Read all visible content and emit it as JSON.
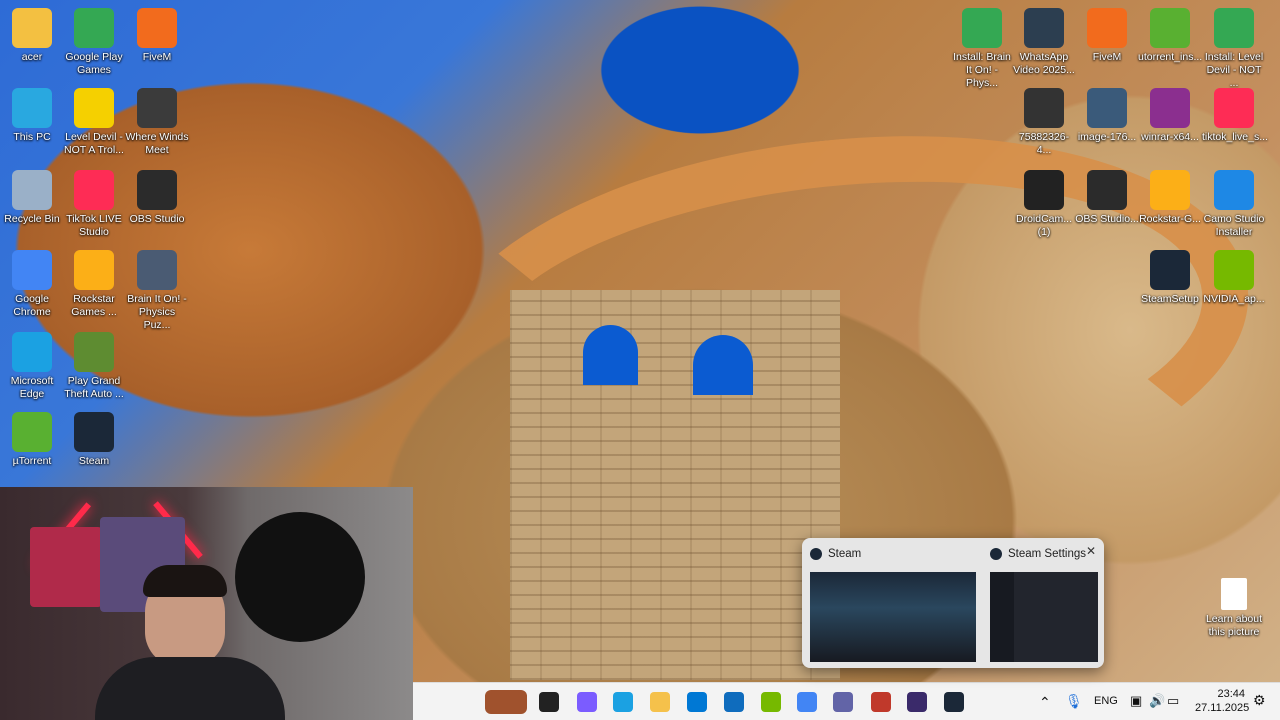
{
  "desktop_left": [
    {
      "label": "acer",
      "icon": "folder-icon",
      "color": "#f3c041"
    },
    {
      "label": "Google Play Games",
      "icon": "google-play-games-icon",
      "color": "#34a853"
    },
    {
      "label": "FiveM",
      "icon": "fivem-icon",
      "color": "#f26b1d"
    },
    {
      "label": "This PC",
      "icon": "monitor-icon",
      "color": "#29a8e0"
    },
    {
      "label": "Level Devil - NOT A Trol...",
      "icon": "level-devil-icon",
      "color": "#f5d000"
    },
    {
      "label": "Where Winds Meet",
      "icon": "where-winds-meet-icon",
      "color": "#3b3b3b"
    },
    {
      "label": "Recycle Bin",
      "icon": "recycle-bin-icon",
      "color": "#9ab0c8"
    },
    {
      "label": "TikTok LIVE Studio",
      "icon": "tiktok-icon",
      "color": "#fe2c55"
    },
    {
      "label": "OBS Studio",
      "icon": "obs-icon",
      "color": "#2b2b2b"
    },
    {
      "label": "Google Chrome",
      "icon": "chrome-icon",
      "color": "#4285f4"
    },
    {
      "label": "Rockstar Games ...",
      "icon": "rockstar-icon",
      "color": "#fcaf17"
    },
    {
      "label": "Brain It On! - Physics Puz...",
      "icon": "brain-it-on-icon",
      "color": "#4a5b73"
    },
    {
      "label": "Microsoft Edge",
      "icon": "edge-icon",
      "color": "#1ba1e2"
    },
    {
      "label": "Play Grand Theft Auto ...",
      "icon": "gta-icon",
      "color": "#5e8c31"
    },
    {
      "label": "µTorrent",
      "icon": "utorrent-icon",
      "color": "#59b031"
    },
    {
      "label": "Steam",
      "icon": "steam-icon",
      "color": "#1b2838"
    }
  ],
  "desktop_right": [
    {
      "label": "Install: Brain It On! - Phys...",
      "icon": "google-play-games-icon",
      "color": "#34a853"
    },
    {
      "label": "WhatsApp Video 2025...",
      "icon": "video-file-icon",
      "color": "#2c3e50"
    },
    {
      "label": "FiveM",
      "icon": "fivem-icon",
      "color": "#f26b1d"
    },
    {
      "label": "utorrent_ins...",
      "icon": "utorrent-icon",
      "color": "#59b031"
    },
    {
      "label": "Install: Level Devil - NOT ...",
      "icon": "google-play-games-icon",
      "color": "#34a853"
    },
    {
      "label": "75882326-4...",
      "icon": "image-file-icon",
      "color": "#333"
    },
    {
      "label": "image-176...",
      "icon": "image-file-icon",
      "color": "#3a5a7a"
    },
    {
      "label": "winrar-x64...",
      "icon": "winrar-icon",
      "color": "#8b2f8f"
    },
    {
      "label": "tiktok_live_s...",
      "icon": "tiktok-icon",
      "color": "#fe2c55"
    },
    {
      "label": "DroidCam... (1)",
      "icon": "droidcam-icon",
      "color": "#222"
    },
    {
      "label": "OBS Studio...",
      "icon": "obs-icon",
      "color": "#2b2b2b"
    },
    {
      "label": "Rockstar-G...",
      "icon": "rockstar-icon",
      "color": "#fcaf17"
    },
    {
      "label": "Camo Studio Installer",
      "icon": "camo-installer-icon",
      "color": "#1e88e5"
    },
    {
      "label": "SteamSetup",
      "icon": "steam-icon",
      "color": "#1b2838"
    },
    {
      "label": "NVIDIA_ap...",
      "icon": "nvidia-icon",
      "color": "#76b900"
    }
  ],
  "learn": {
    "label": "Learn about this picture",
    "icon": "document-icon"
  },
  "preview": {
    "items": [
      {
        "title": "Steam"
      },
      {
        "title": "Steam Settings"
      }
    ]
  },
  "taskbar": {
    "apps": [
      {
        "name": "widgets",
        "color": "#a0522d"
      },
      {
        "name": "task-view",
        "color": "#222"
      },
      {
        "name": "copilot",
        "color": "#7b5cff"
      },
      {
        "name": "edge",
        "color": "#1ba1e2"
      },
      {
        "name": "file-explorer",
        "color": "#f5c14b"
      },
      {
        "name": "microsoft-store",
        "color": "#0078d4"
      },
      {
        "name": "outlook",
        "color": "#0f6cbd"
      },
      {
        "name": "nvidia",
        "color": "#76b900"
      },
      {
        "name": "chrome",
        "color": "#4285f4"
      },
      {
        "name": "teams",
        "color": "#6264a7"
      },
      {
        "name": "davinci",
        "color": "#c0392b"
      },
      {
        "name": "obs",
        "color": "#3a2a6a"
      },
      {
        "name": "steam",
        "color": "#1b2838"
      }
    ],
    "lang": "ENG",
    "time": "23:44",
    "date": "27.11.2025"
  }
}
